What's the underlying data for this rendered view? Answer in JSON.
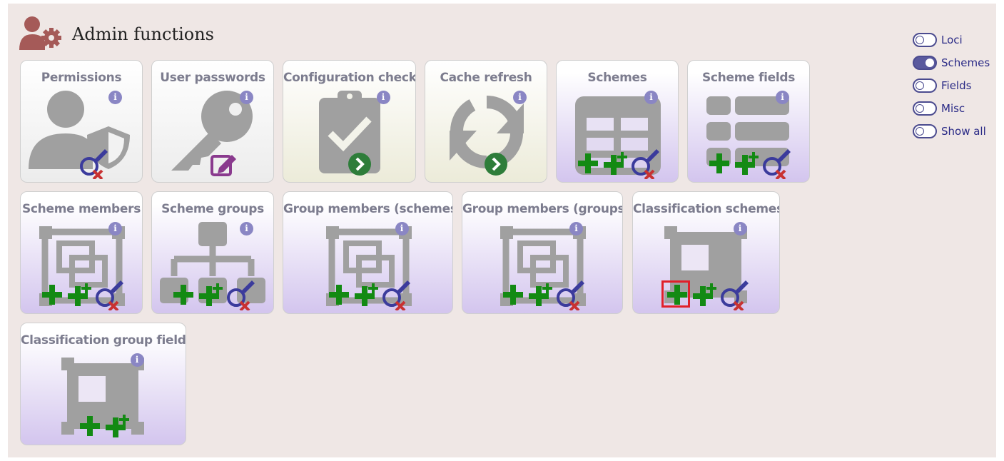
{
  "header": {
    "title": "Admin functions",
    "icon": "admin-user-gear-icon"
  },
  "colors": {
    "accent": "#5a5a9e",
    "plus": "#138a13",
    "info": "#8a86c4",
    "header_icon": "#a55a58"
  },
  "tiles": [
    {
      "label": "Permissions",
      "info": "i",
      "style": "grey",
      "icon": "user-shield-icon",
      "actions": [
        "query-edit-delete-icon"
      ]
    },
    {
      "label": "User passwords",
      "info": "i",
      "style": "grey",
      "icon": "key-icon",
      "actions": [
        "edit-icon"
      ]
    },
    {
      "label": "Configuration check",
      "info": "i",
      "style": "green",
      "icon": "clipboard-check-icon",
      "actions": [
        "go-icon"
      ]
    },
    {
      "label": "Cache refresh",
      "info": "i",
      "style": "green",
      "icon": "refresh-icon",
      "actions": [
        "go-icon"
      ]
    },
    {
      "label": "Schemes",
      "info": "i",
      "style": "purple",
      "icon": "table-icon",
      "actions": [
        "add-icon",
        "batch-add-icon",
        "query-edit-delete-icon"
      ]
    },
    {
      "label": "Scheme fields",
      "info": "i",
      "style": "purple",
      "icon": "list-icon",
      "actions": [
        "add-icon",
        "batch-add-icon",
        "query-edit-delete-icon"
      ]
    },
    {
      "label": "Scheme members",
      "info": "i",
      "style": "purple",
      "icon": "object-group-icon",
      "actions": [
        "add-icon",
        "batch-add-icon",
        "query-edit-delete-icon"
      ]
    },
    {
      "label": "Scheme groups",
      "info": "i",
      "style": "purple",
      "icon": "sitemap-icon",
      "actions": [
        "add-icon",
        "batch-add-icon",
        "query-edit-delete-icon"
      ]
    },
    {
      "label": "Group members (schemes)",
      "info": "i",
      "style": "purple",
      "icon": "object-group-icon",
      "actions": [
        "add-icon",
        "batch-add-icon",
        "query-edit-delete-icon"
      ]
    },
    {
      "label": "Group members (groups)",
      "info": "i",
      "style": "purple",
      "icon": "object-group-icon",
      "actions": [
        "add-icon",
        "batch-add-icon",
        "query-edit-delete-icon"
      ]
    },
    {
      "label": "Classification schemes",
      "info": "i",
      "style": "purple",
      "icon": "object-ungroup-icon",
      "actions": [
        "add-icon",
        "batch-add-icon",
        "query-edit-delete-icon"
      ]
    },
    {
      "label": "Classification group fields",
      "info": "i",
      "style": "purple",
      "icon": "object-ungroup-icon",
      "actions": [
        "add-icon",
        "batch-add-icon"
      ]
    }
  ],
  "toggles": [
    {
      "label": "Loci",
      "on": false
    },
    {
      "label": "Schemes",
      "on": true
    },
    {
      "label": "Fields",
      "on": false
    },
    {
      "label": "Misc",
      "on": false
    },
    {
      "label": "Show all",
      "on": false
    }
  ]
}
